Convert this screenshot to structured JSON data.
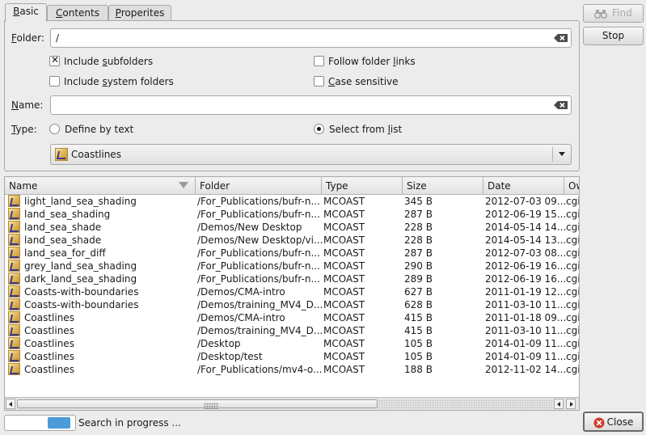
{
  "tabs": [
    {
      "label": "Basic",
      "underline": "B",
      "active": true
    },
    {
      "label": "Contents",
      "underline": "C"
    },
    {
      "label": "Properites",
      "underline": "P"
    }
  ],
  "folder": {
    "label": "Folder:",
    "value": "/"
  },
  "options": {
    "include_subfolders": {
      "label": "Include subfolders",
      "checked": true
    },
    "include_system_folders": {
      "label": "Include system folders",
      "checked": false
    },
    "follow_folder_links": {
      "label": "Follow folder links",
      "checked": false
    },
    "case_sensitive": {
      "label": "Case sensitive",
      "checked": false
    }
  },
  "name": {
    "label": "Name:",
    "value": ""
  },
  "type": {
    "label": "Type:",
    "define_by_text": "Define by text",
    "select_from_list": "Select from list",
    "selected_option": "select_from_list",
    "list_value": "Coastlines",
    "list_icon": "coast-icon"
  },
  "buttons": {
    "find": "Find",
    "stop": "Stop",
    "close": "Close"
  },
  "icons": {
    "find": "binoculars-icon",
    "close": "close-circle-icon"
  },
  "colors": {
    "close_icon": "#d23a2a",
    "progress": "#4a9bd8"
  },
  "results": {
    "columns": [
      "Name",
      "Folder",
      "Type",
      "Size",
      "Date",
      "Ow"
    ],
    "rows": [
      [
        "light_land_sea_shading",
        "/For_Publications/bufr-n...",
        "MCOAST",
        "345 B",
        "2012-07-03 09...",
        "cgi"
      ],
      [
        "land_sea_shading",
        "/For_Publications/bufr-n...",
        "MCOAST",
        "287 B",
        "2012-06-19 15...",
        "cgi"
      ],
      [
        "land_sea_shade",
        "/Demos/New Desktop",
        "MCOAST",
        "228 B",
        "2014-05-14 14...",
        "cgi"
      ],
      [
        "land_sea_shade",
        "/Demos/New Desktop/vi...",
        "MCOAST",
        "228 B",
        "2014-05-14 13...",
        "cgi"
      ],
      [
        "land_sea_for_diff",
        "/For_Publications/bufr-n...",
        "MCOAST",
        "287 B",
        "2012-07-03 08...",
        "cgi"
      ],
      [
        "grey_land_sea_shading",
        "/For_Publications/bufr-n...",
        "MCOAST",
        "290 B",
        "2012-06-19 16...",
        "cgi"
      ],
      [
        "dark_land_sea_shading",
        "/For_Publications/bufr-n...",
        "MCOAST",
        "289 B",
        "2012-06-19 16...",
        "cgi"
      ],
      [
        "Coasts-with-boundaries",
        "/Demos/CMA-intro",
        "MCOAST",
        "627 B",
        "2011-01-19 12...",
        "cgi"
      ],
      [
        "Coasts-with-boundaries",
        "/Demos/training_MV4_D...",
        "MCOAST",
        "628 B",
        "2011-03-10 11...",
        "cgi"
      ],
      [
        "Coastlines",
        "/Demos/CMA-intro",
        "MCOAST",
        "415 B",
        "2011-01-18 09...",
        "cgi"
      ],
      [
        "Coastlines",
        "/Demos/training_MV4_D...",
        "MCOAST",
        "415 B",
        "2011-03-10 11...",
        "cgi"
      ],
      [
        "Coastlines",
        "/Desktop",
        "MCOAST",
        "105 B",
        "2014-01-09 11...",
        "cgi"
      ],
      [
        "Coastlines",
        "/Desktop/test",
        "MCOAST",
        "105 B",
        "2014-01-09 11...",
        "cgi"
      ],
      [
        "Coastlines",
        "/For_Publications/mv4-o...",
        "MCOAST",
        "188 B",
        "2012-11-02 14...",
        "cgi"
      ]
    ]
  },
  "status": {
    "text": "Search in progress ..."
  }
}
